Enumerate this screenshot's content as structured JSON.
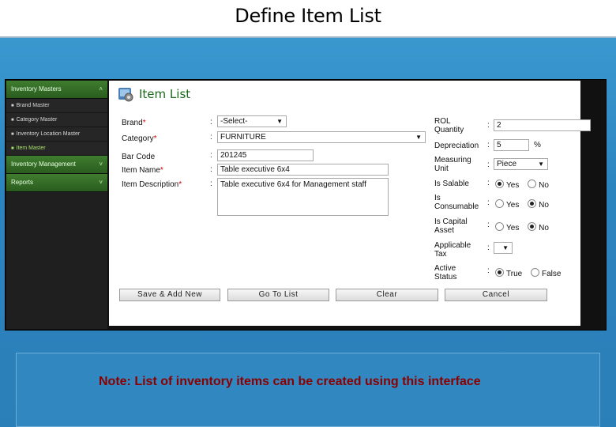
{
  "slide": {
    "title": "Define Item List",
    "note": "Note: List of inventory items can be created using this interface"
  },
  "sidebar": {
    "sections": [
      {
        "label": "Inventory Masters",
        "chevron": "˄"
      },
      {
        "label": "Inventory Management",
        "chevron": "˅"
      },
      {
        "label": "Reports",
        "chevron": "˅"
      }
    ],
    "items": [
      {
        "label": "Brand Master"
      },
      {
        "label": "Category Master"
      },
      {
        "label": "Inventory Location Master"
      },
      {
        "label": "Item Master"
      }
    ]
  },
  "panel": {
    "title": "Item List",
    "icon": "gear-icon"
  },
  "form": {
    "brand": {
      "label": "Brand",
      "value": "-Select-"
    },
    "category": {
      "label": "Category",
      "value": "FURNITURE"
    },
    "barcode": {
      "label": "Bar Code",
      "value": "201245"
    },
    "item_name": {
      "label": "Item Name",
      "value": "Table executive 6x4"
    },
    "item_description": {
      "label": "Item Description",
      "value": "Table executive 6x4 for Management staff"
    },
    "rol_quantity": {
      "label": "ROL Quantity",
      "value": "2"
    },
    "depreciation": {
      "label": "Depreciation",
      "value": "5",
      "unit": "%"
    },
    "measuring_unit": {
      "label": "Measuring Unit",
      "value": "Piece"
    },
    "is_salable": {
      "label": "Is Salable",
      "yes": "Yes",
      "no": "No",
      "selected": "Yes"
    },
    "is_consumable": {
      "label": "Is Consumable",
      "yes": "Yes",
      "no": "No",
      "selected": "No"
    },
    "is_capital_asset": {
      "label": "Is Capital Asset",
      "yes": "Yes",
      "no": "No",
      "selected": "No"
    },
    "applicable_tax": {
      "label": "Applicable Tax",
      "value": ""
    },
    "active_status": {
      "label": "Active Status",
      "yes": "True",
      "no": "False",
      "selected": "True"
    },
    "required_marker": "*",
    "colon": ":"
  },
  "buttons": {
    "save_add_new": "Save & Add New",
    "go_to_list": "Go To List",
    "clear": "Clear",
    "cancel": "Cancel"
  }
}
